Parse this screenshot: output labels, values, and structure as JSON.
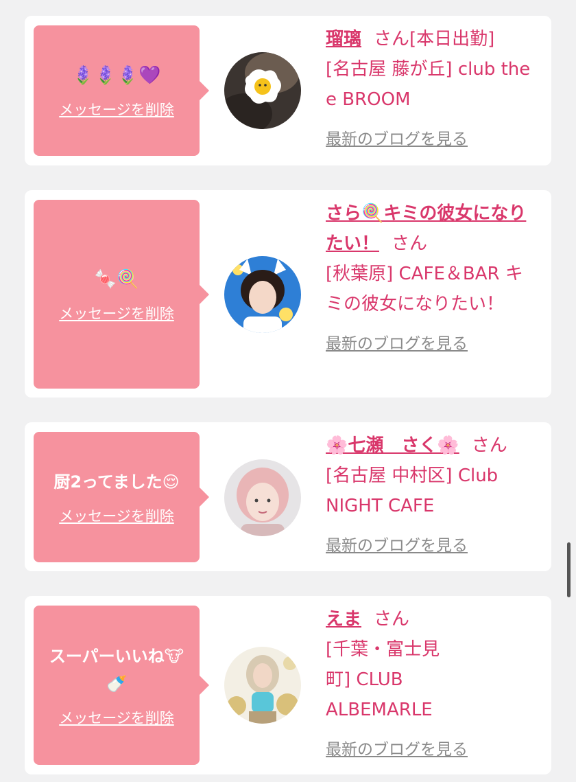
{
  "delete_label": "メッセージを削除",
  "blog_label": "最新のブログを見る",
  "honorific": "さん",
  "colors": {
    "bubble": "#f6929e",
    "accent": "#d9376b",
    "background": "#f1f1f2"
  },
  "cards": [
    {
      "message": "🪻🪻🪻💜",
      "name": "瑠璃",
      "status": "[本日出勤]",
      "shop": "[名古屋 藤が丘] club the e BROOM"
    },
    {
      "message": "🍬🍭",
      "name": "さら🍭キミの彼女になりたい！",
      "status": "",
      "shop": "[秋葉原] CAFE＆BAR キミの彼女になりたい！"
    },
    {
      "message": "厨2ってました😌",
      "name": "🌸七瀬　さく🌸",
      "status": "",
      "shop": "[名古屋 中村区] Club NIGHT CAFE"
    },
    {
      "message": "スーパーいいね🐮🍼",
      "name": "えま",
      "status": "",
      "shop": "[千葉・富士見町] CLUB ALBEMARLE"
    }
  ]
}
